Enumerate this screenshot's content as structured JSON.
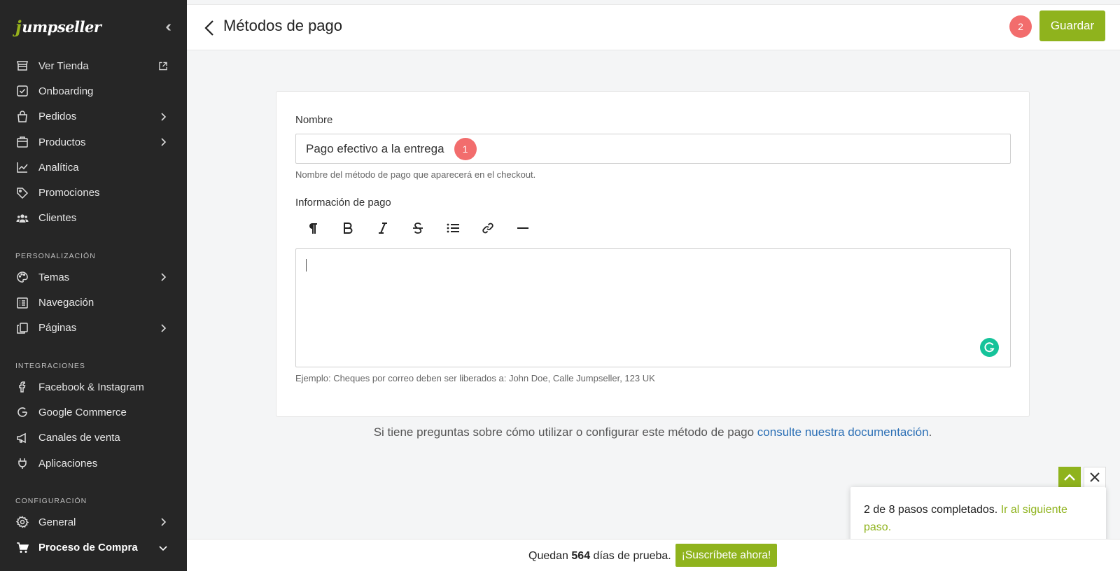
{
  "colors": {
    "accent": "#8fb31d",
    "badge": "#f26d6d",
    "sidebar_bg": "#262626",
    "link": "#2b6fb5"
  },
  "sidebar": {
    "logo": "Jumpseller",
    "items": [
      {
        "label": "Ver Tienda",
        "icon": "store-icon"
      },
      {
        "label": "Onboarding",
        "icon": "checkbox-icon"
      },
      {
        "label": "Pedidos",
        "icon": "shopping-bag-icon"
      },
      {
        "label": "Productos",
        "icon": "box-icon"
      },
      {
        "label": "Analítica",
        "icon": "chart-icon"
      },
      {
        "label": "Promociones",
        "icon": "tag-icon"
      },
      {
        "label": "Clientes",
        "icon": "users-icon"
      }
    ],
    "sections": {
      "personalizacion": {
        "title": "PERSONALIZACIÓN",
        "items": [
          {
            "label": "Temas",
            "icon": "palette-icon"
          },
          {
            "label": "Navegación",
            "icon": "list-icon"
          },
          {
            "label": "Páginas",
            "icon": "pages-icon"
          }
        ]
      },
      "integraciones": {
        "title": "INTEGRACIONES",
        "items": [
          {
            "label": "Facebook & Instagram",
            "icon": "facebook-icon"
          },
          {
            "label": "Google Commerce",
            "icon": "google-icon"
          },
          {
            "label": "Canales de venta",
            "icon": "megaphone-icon"
          },
          {
            "label": "Aplicaciones",
            "icon": "plug-icon"
          }
        ]
      },
      "configuracion": {
        "title": "CONFIGURACIÓN",
        "items": [
          {
            "label": "General",
            "icon": "gear-icon"
          },
          {
            "label": "Proceso de Compra",
            "icon": "cart-icon"
          }
        ]
      }
    }
  },
  "header": {
    "title": "Métodos de pago",
    "badge": "2",
    "save_label": "Guardar"
  },
  "form": {
    "name_label": "Nombre",
    "name_value": "Pago efectivo a la entrega",
    "name_badge": "1",
    "name_help": "Nombre del método de pago que aparecerá en el checkout.",
    "info_label": "Información de pago",
    "info_help": "Ejemplo: Cheques por correo deben ser liberados a: John Doe, Calle Jumpseller, 123 UK"
  },
  "doc": {
    "text": "Si tiene preguntas sobre cómo utilizar o configurar este método de pago ",
    "link": "consulte nuestra documentación",
    "end": "."
  },
  "footer": {
    "trial_prefix": "Quedan ",
    "trial_days": "564",
    "trial_suffix": " días de prueba.",
    "subscribe_label": "¡Suscríbete ahora!"
  },
  "onboarding": {
    "text": "2 de 8 pasos completados. ",
    "link": "Ir al siguiente paso.",
    "progress": 0.25
  }
}
